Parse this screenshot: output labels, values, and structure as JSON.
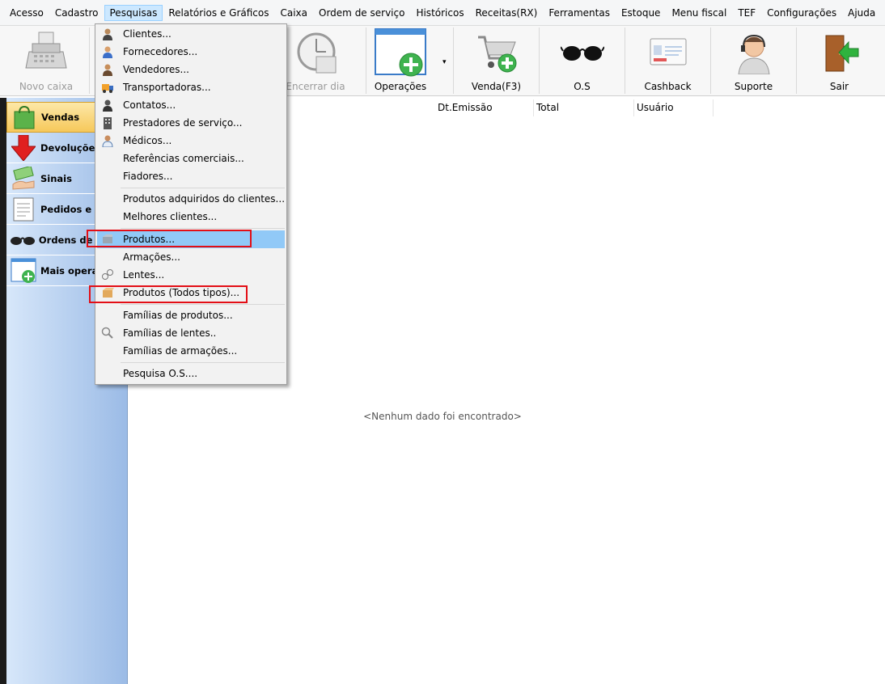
{
  "menubar": {
    "items": [
      "Acesso",
      "Cadastro",
      "Pesquisas",
      "Relatórios e Gráficos",
      "Caixa",
      "Ordem de serviço",
      "Históricos",
      "Receitas(RX)",
      "Ferramentas",
      "Estoque",
      "Menu fiscal",
      "TEF",
      "Configurações",
      "Ajuda"
    ],
    "active": "Pesquisas"
  },
  "toolbar": {
    "novo_caixa": "Novo caixa",
    "encerrar_dia": "Encerrar dia",
    "operacoes": "Operações",
    "venda": "Venda(F3)",
    "os": "O.S",
    "cashback": "Cashback",
    "suporte": "Suporte",
    "sair": "Sair",
    "dropdown_arrow": "▾"
  },
  "sidebar": {
    "items": [
      "Vendas",
      "Devoluções",
      "Sinais",
      "Pedidos e O.S",
      "Ordens de serviço",
      "Mais operações"
    ],
    "selected": "Vendas"
  },
  "grid": {
    "columns": [
      "Dt.Emissão",
      "Total",
      "Usuário"
    ],
    "empty_text": "<Nenhum dado foi encontrado>"
  },
  "dropdown": {
    "items": [
      "Clientes...",
      "Fornecedores...",
      "Vendedores...",
      "Transportadoras...",
      "Contatos...",
      "Prestadores de serviço...",
      "Médicos...",
      "Referências comerciais...",
      "Fiadores...",
      "Produtos adquiridos do clientes...",
      "Melhores clientes...",
      "Produtos...",
      "Armações...",
      "Lentes...",
      "Produtos (Todos tipos)...",
      "Famílias de produtos...",
      "Famílias de lentes..",
      "Famílias de armações...",
      "Pesquisa O.S...."
    ],
    "highlighted": "Produtos..."
  },
  "colors": {
    "highlight": "#91c9f7",
    "annotation_red": "#e30e16",
    "selected_sidebar": "#f6c85a"
  }
}
